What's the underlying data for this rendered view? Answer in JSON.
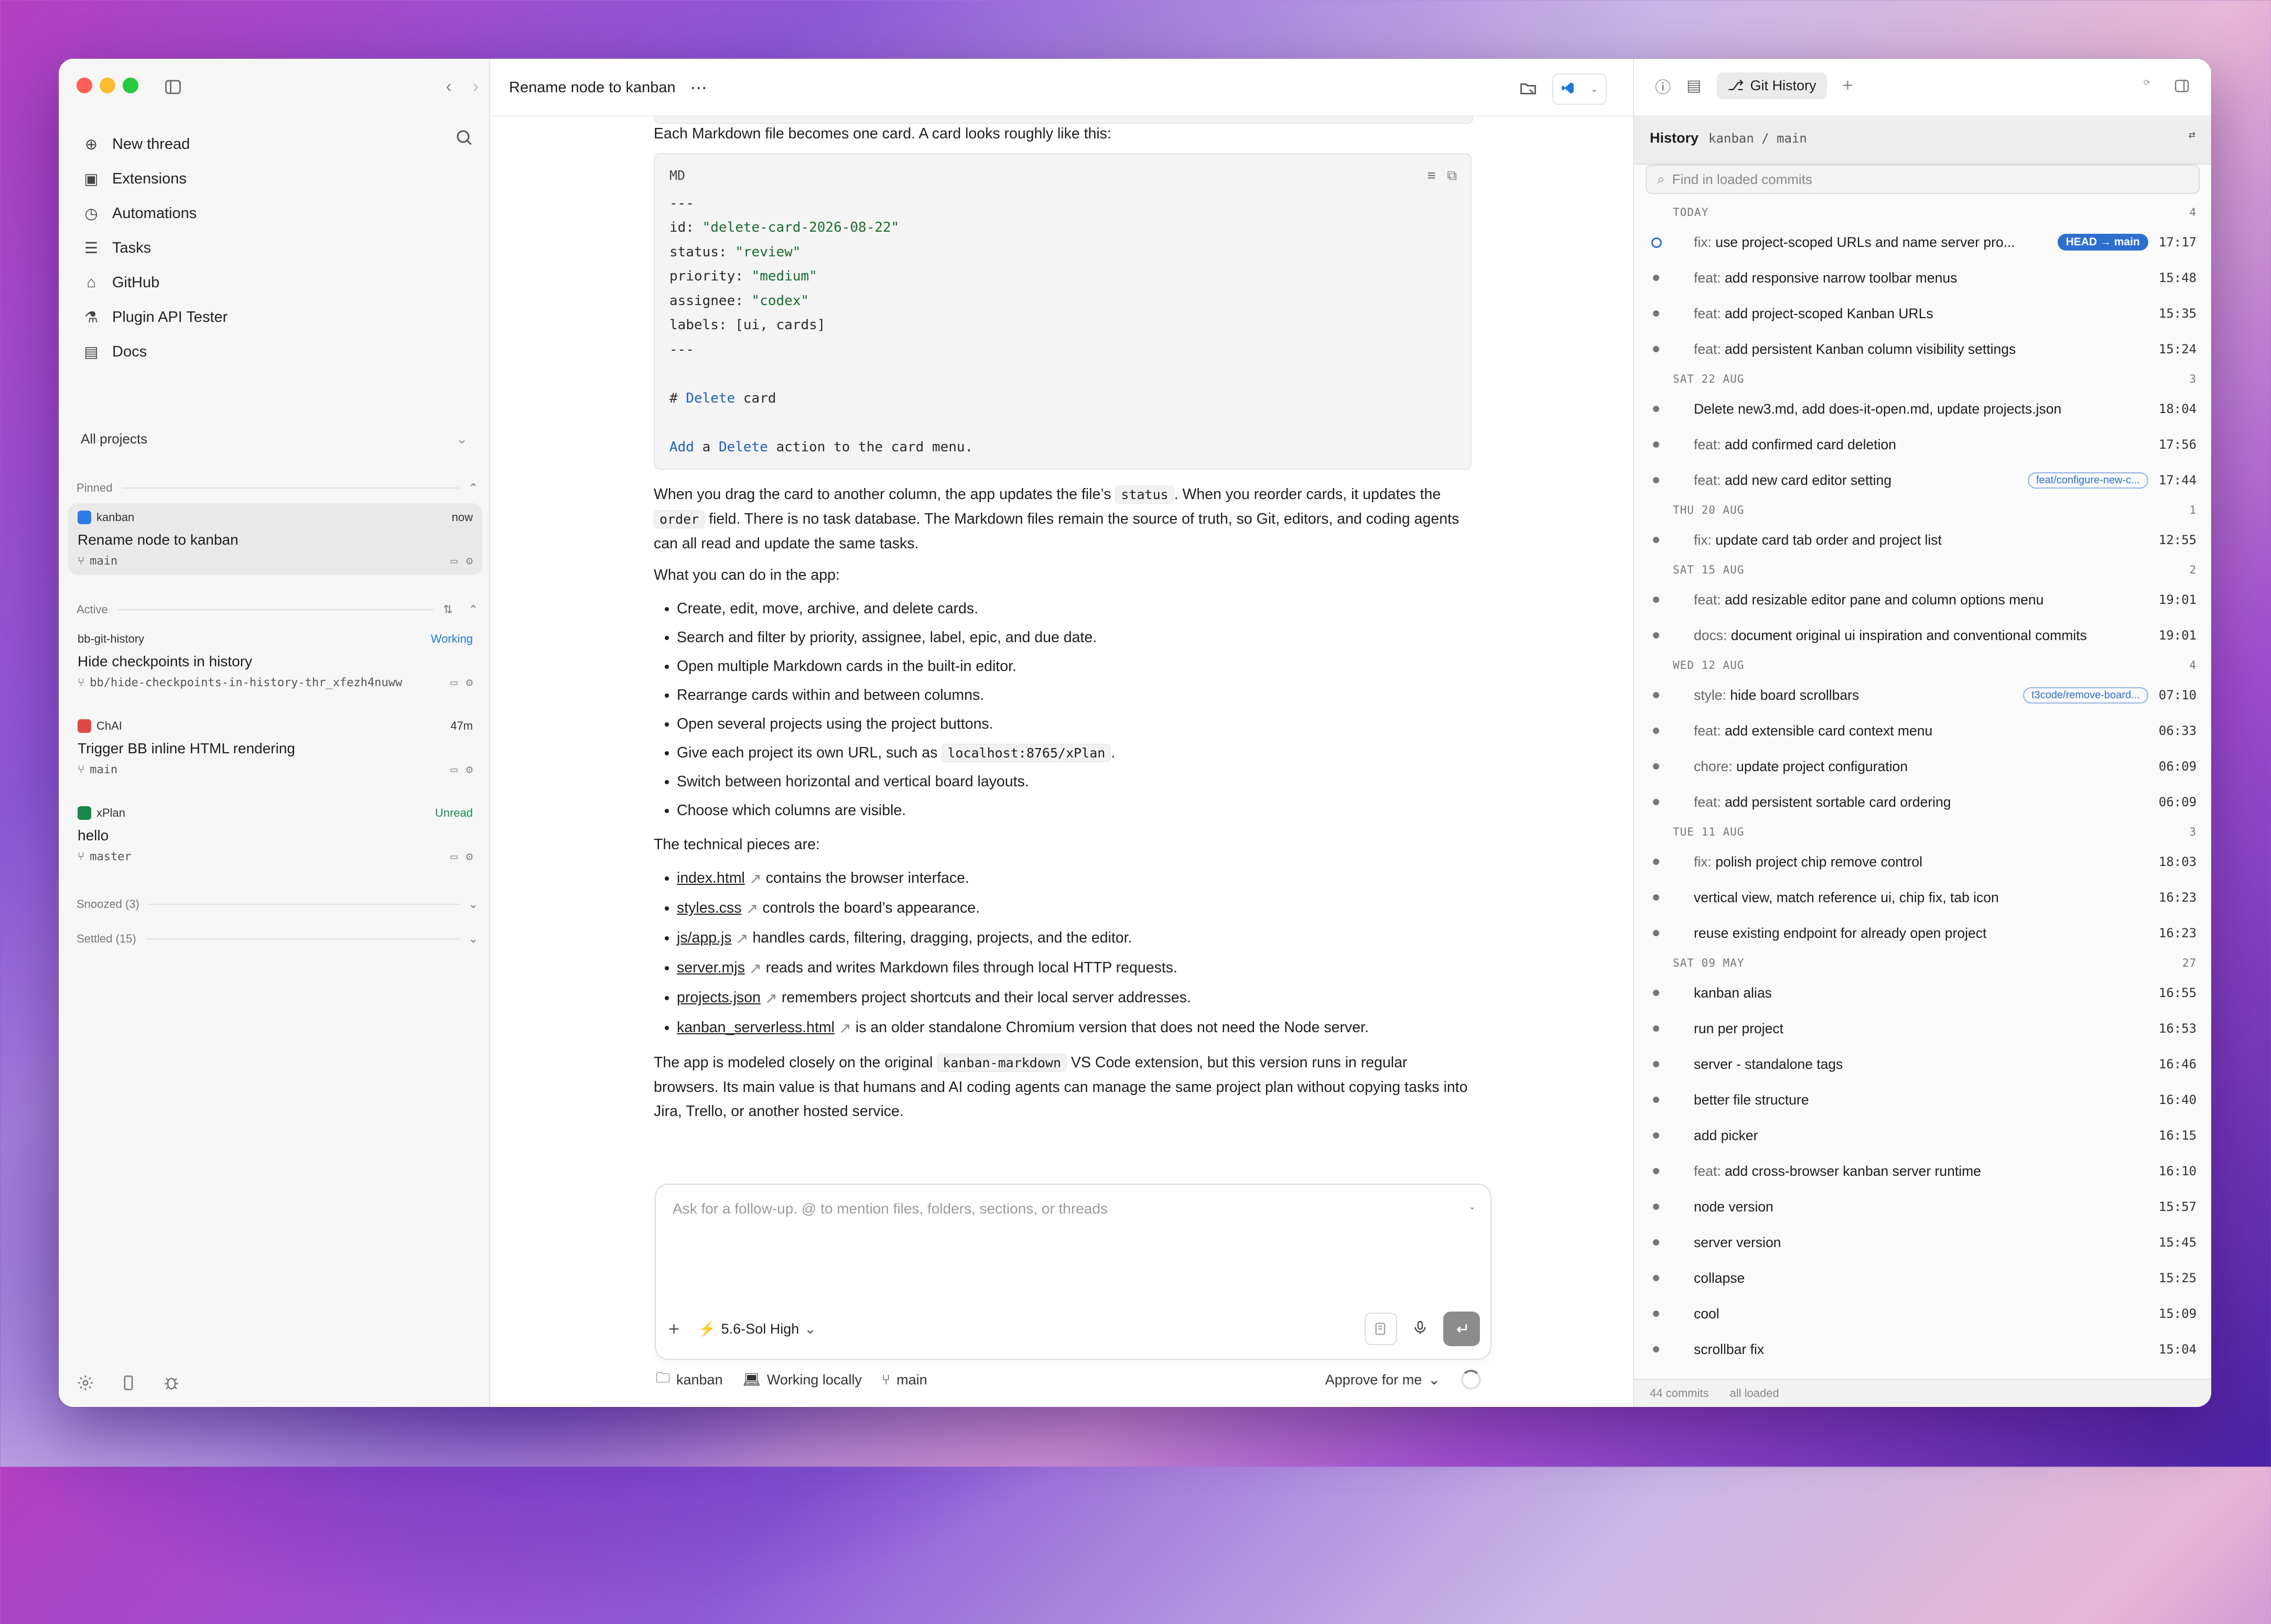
{
  "sidebar": {
    "menu": [
      {
        "label": "New thread",
        "icon": "plus-circle-icon"
      },
      {
        "label": "Extensions",
        "icon": "briefcase-icon"
      },
      {
        "label": "Automations",
        "icon": "clock-icon"
      },
      {
        "label": "Tasks",
        "icon": "checklist-icon"
      },
      {
        "label": "GitHub",
        "icon": "github-icon"
      },
      {
        "label": "Plugin API Tester",
        "icon": "flask-icon"
      },
      {
        "label": "Docs",
        "icon": "doc-icon"
      }
    ],
    "projects_label": "All projects",
    "pinned_label": "Pinned",
    "active_label": "Active",
    "snoozed_label": "Snoozed (3)",
    "settled_label": "Settled (15)",
    "pinned_threads": [
      {
        "project": "kanban",
        "status": "now",
        "title": "Rename node to kanban",
        "branch": "main",
        "color": "#2f7be6"
      }
    ],
    "active_threads": [
      {
        "project": "bb-git-history",
        "status": "Working",
        "title": "Hide checkpoints in history",
        "branch": "bb/hide-checkpoints-in-history-thr_xfezh4nuww"
      },
      {
        "project": "ChAI",
        "status": "47m",
        "title": "Trigger BB inline HTML rendering",
        "branch": "main",
        "color": "#e04848"
      },
      {
        "project": "xPlan",
        "status": "Unread",
        "title": "hello",
        "branch": "master",
        "color": "#18894a"
      }
    ]
  },
  "main": {
    "title": "Rename node to kanban",
    "intro": "Each Markdown file becomes one card. A card looks roughly like this:",
    "code": {
      "lang": "MD",
      "sep": "---",
      "id_key": "id: ",
      "id_val": "\"delete-card-2026-08-22\"",
      "status_key": "status: ",
      "status_val": "\"review\"",
      "priority_key": "priority: ",
      "priority_val": "\"medium\"",
      "assignee_key": "assignee: ",
      "assignee_val": "\"codex\"",
      "labels": "labels: [ui, cards]",
      "heading_hash": "# ",
      "heading_kw": "Delete",
      "heading_rest": " card",
      "body_add": "Add",
      "body_a": " a ",
      "body_del": "Delete",
      "body_rest": " action to the card menu."
    },
    "p1_a": "When you drag the card to another column, the app updates the file’s ",
    "p1_code": "status",
    "p1_b": ". When you reorder cards, it updates the ",
    "p1_code2": "order",
    "p1_c": " field. There is no task database. The Markdown files remain the source of truth, so Git, editors, and coding agents can all read and update the same tasks.",
    "p2": "What you can do in the app:",
    "features": [
      "Create, edit, move, archive, and delete cards.",
      "Search and filter by priority, assignee, label, epic, and due date.",
      "Open multiple Markdown cards in the built-in editor.",
      "Rearrange cards within and between columns.",
      "Open several projects using the project buttons."
    ],
    "feature_url_a": "Give each project its own URL, such as ",
    "feature_url_code": "localhost:8765/xPlan",
    "feature_url_b": ".",
    "features2": [
      "Switch between horizontal and vertical board layouts.",
      "Choose which columns are visible."
    ],
    "p3": "The technical pieces are:",
    "pieces": [
      {
        "file": "index.html",
        "desc": "contains the browser interface."
      },
      {
        "file": "styles.css",
        "desc": "controls the board’s appearance."
      },
      {
        "file": "js/app.js",
        "desc": "handles cards, filtering, dragging, projects, and the editor."
      },
      {
        "file": "server.mjs",
        "desc": "reads and writes Markdown files through local HTTP requests."
      },
      {
        "file": "projects.json",
        "desc": "remembers project shortcuts and their local server addresses."
      },
      {
        "file": "kanban_serverless.html",
        "desc": "is an older standalone Chromium version that does not need the Node server."
      }
    ],
    "p4_a": "The app is modeled closely on the original ",
    "p4_code": "kanban-markdown",
    "p4_b": " VS Code extension, but this version runs in regular browsers. Its main value is that humans and AI coding agents can manage the same project plan without copying tasks into Jira, Trello, or another hosted service.",
    "composer_placeholder": "Ask for a follow-up. @ to mention files, folders, sections, or threads",
    "model": "5.6-Sol High",
    "footer_project": "kanban",
    "footer_env": "Working locally",
    "footer_branch": "main",
    "approve": "Approve for me"
  },
  "right": {
    "tab": "Git History",
    "history_title": "History",
    "history_branch": "kanban / main",
    "find_placeholder": "Find in loaded commits",
    "days": [
      {
        "label": "TODAY",
        "count": "4",
        "commits": [
          {
            "type": "fix:",
            "msg": " use project-scoped URLs and name server pro...",
            "time": "17:17",
            "head": "HEAD → main"
          },
          {
            "type": "feat:",
            "msg": " add responsive narrow toolbar menus",
            "time": "15:48"
          },
          {
            "type": "feat:",
            "msg": " add project-scoped Kanban URLs",
            "time": "15:35"
          },
          {
            "type": "feat:",
            "msg": " add persistent Kanban column visibility settings",
            "time": "15:24"
          }
        ]
      },
      {
        "label": "SAT 22 AUG",
        "count": "3",
        "commits": [
          {
            "type": "",
            "msg": "Delete new3.md, add does-it-open.md, update projects.json",
            "time": "18:04"
          },
          {
            "type": "feat:",
            "msg": " add confirmed card deletion",
            "time": "17:56"
          },
          {
            "type": "feat:",
            "msg": " add new card editor setting",
            "time": "17:44",
            "branch": "feat/configure-new-c..."
          }
        ]
      },
      {
        "label": "THU 20 AUG",
        "count": "1",
        "commits": [
          {
            "type": "fix:",
            "msg": " update card tab order and project list",
            "time": "12:55"
          }
        ]
      },
      {
        "label": "SAT 15 AUG",
        "count": "2",
        "commits": [
          {
            "type": "feat:",
            "msg": " add resizable editor pane and column options menu",
            "time": "19:01"
          },
          {
            "type": "docs:",
            "msg": " document original ui inspiration and conventional commits",
            "time": "19:01"
          }
        ]
      },
      {
        "label": "WED 12 AUG",
        "count": "4",
        "commits": [
          {
            "type": "style:",
            "msg": " hide board scrollbars",
            "time": "07:10",
            "branch": "t3code/remove-board..."
          },
          {
            "type": "feat:",
            "msg": " add extensible card context menu",
            "time": "06:33"
          },
          {
            "type": "chore:",
            "msg": " update project configuration",
            "time": "06:09"
          },
          {
            "type": "feat:",
            "msg": " add persistent sortable card ordering",
            "time": "06:09"
          }
        ]
      },
      {
        "label": "TUE 11 AUG",
        "count": "3",
        "commits": [
          {
            "type": "fix:",
            "msg": " polish project chip remove control",
            "time": "18:03"
          },
          {
            "type": "",
            "msg": "vertical view, match reference ui, chip fix, tab icon",
            "time": "16:23"
          },
          {
            "type": "",
            "msg": "reuse existing endpoint for already open project",
            "time": "16:23"
          }
        ]
      },
      {
        "label": "SAT 09 MAY",
        "count": "27",
        "commits": [
          {
            "type": "",
            "msg": "kanban alias",
            "time": "16:55"
          },
          {
            "type": "",
            "msg": "run per project",
            "time": "16:53"
          },
          {
            "type": "",
            "msg": "server - standalone tags",
            "time": "16:46"
          },
          {
            "type": "",
            "msg": "better file structure",
            "time": "16:40"
          },
          {
            "type": "",
            "msg": "add picker",
            "time": "16:15"
          },
          {
            "type": "feat:",
            "msg": " add cross-browser kanban server runtime",
            "time": "16:10"
          },
          {
            "type": "",
            "msg": "node version",
            "time": "15:57"
          },
          {
            "type": "",
            "msg": "server version",
            "time": "15:45"
          },
          {
            "type": "",
            "msg": "collapse",
            "time": "15:25"
          },
          {
            "type": "",
            "msg": "cool",
            "time": "15:09"
          },
          {
            "type": "",
            "msg": "scrollbar fix",
            "time": "15:04"
          }
        ]
      }
    ],
    "footer_count": "44 commits",
    "footer_loaded": "all loaded"
  }
}
